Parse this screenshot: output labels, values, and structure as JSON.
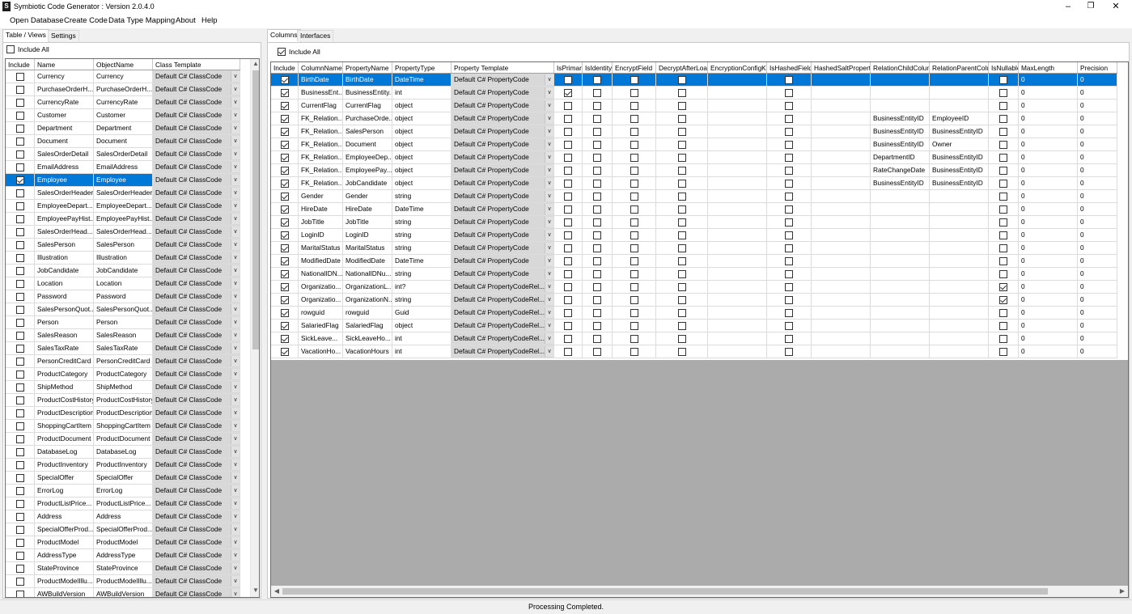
{
  "window": {
    "title": "Symbiotic Code Generator : Version 2.0.4.0"
  },
  "menu": [
    "Open Database",
    "Create Code",
    "Data Type Mapping",
    "About",
    "Help"
  ],
  "left_tabs": [
    "Table / Views",
    "Settings"
  ],
  "right_tabs": [
    "Columns",
    "Interfaces"
  ],
  "include_all_label": "Include All",
  "tables": {
    "headers": [
      "Include",
      "Name",
      "ObjectName",
      "Class Template"
    ],
    "template": "Default C# ClassCode",
    "rows": [
      {
        "inc": false,
        "name": "Currency",
        "obj": "Currency"
      },
      {
        "inc": false,
        "name": "PurchaseOrderH...",
        "obj": "PurchaseOrderH..."
      },
      {
        "inc": false,
        "name": "CurrencyRate",
        "obj": "CurrencyRate"
      },
      {
        "inc": false,
        "name": "Customer",
        "obj": "Customer"
      },
      {
        "inc": false,
        "name": "Department",
        "obj": "Department"
      },
      {
        "inc": false,
        "name": "Document",
        "obj": "Document"
      },
      {
        "inc": false,
        "name": "SalesOrderDetail",
        "obj": "SalesOrderDetail"
      },
      {
        "inc": false,
        "name": "EmailAddress",
        "obj": "EmailAddress"
      },
      {
        "inc": true,
        "name": "Employee",
        "obj": "Employee",
        "selected": true
      },
      {
        "inc": false,
        "name": "SalesOrderHeader",
        "obj": "SalesOrderHeader"
      },
      {
        "inc": false,
        "name": "EmployeeDepart...",
        "obj": "EmployeeDepart..."
      },
      {
        "inc": false,
        "name": "EmployeePayHist...",
        "obj": "EmployeePayHist..."
      },
      {
        "inc": false,
        "name": "SalesOrderHead...",
        "obj": "SalesOrderHead..."
      },
      {
        "inc": false,
        "name": "SalesPerson",
        "obj": "SalesPerson"
      },
      {
        "inc": false,
        "name": "Illustration",
        "obj": "Illustration"
      },
      {
        "inc": false,
        "name": "JobCandidate",
        "obj": "JobCandidate"
      },
      {
        "inc": false,
        "name": "Location",
        "obj": "Location"
      },
      {
        "inc": false,
        "name": "Password",
        "obj": "Password"
      },
      {
        "inc": false,
        "name": "SalesPersonQuot...",
        "obj": "SalesPersonQuot..."
      },
      {
        "inc": false,
        "name": "Person",
        "obj": "Person"
      },
      {
        "inc": false,
        "name": "SalesReason",
        "obj": "SalesReason"
      },
      {
        "inc": false,
        "name": "SalesTaxRate",
        "obj": "SalesTaxRate"
      },
      {
        "inc": false,
        "name": "PersonCreditCard",
        "obj": "PersonCreditCard"
      },
      {
        "inc": false,
        "name": "ProductCategory",
        "obj": "ProductCategory"
      },
      {
        "inc": false,
        "name": "ShipMethod",
        "obj": "ShipMethod"
      },
      {
        "inc": false,
        "name": "ProductCostHistory",
        "obj": "ProductCostHistory"
      },
      {
        "inc": false,
        "name": "ProductDescription",
        "obj": "ProductDescription"
      },
      {
        "inc": false,
        "name": "ShoppingCartItem",
        "obj": "ShoppingCartItem"
      },
      {
        "inc": false,
        "name": "ProductDocument",
        "obj": "ProductDocument"
      },
      {
        "inc": false,
        "name": "DatabaseLog",
        "obj": "DatabaseLog"
      },
      {
        "inc": false,
        "name": "ProductInventory",
        "obj": "ProductInventory"
      },
      {
        "inc": false,
        "name": "SpecialOffer",
        "obj": "SpecialOffer"
      },
      {
        "inc": false,
        "name": "ErrorLog",
        "obj": "ErrorLog"
      },
      {
        "inc": false,
        "name": "ProductListPrice...",
        "obj": "ProductListPrice..."
      },
      {
        "inc": false,
        "name": "Address",
        "obj": "Address"
      },
      {
        "inc": false,
        "name": "SpecialOfferProd...",
        "obj": "SpecialOfferProd..."
      },
      {
        "inc": false,
        "name": "ProductModel",
        "obj": "ProductModel"
      },
      {
        "inc": false,
        "name": "AddressType",
        "obj": "AddressType"
      },
      {
        "inc": false,
        "name": "StateProvince",
        "obj": "StateProvince"
      },
      {
        "inc": false,
        "name": "ProductModelIllu...",
        "obj": "ProductModelIllu..."
      },
      {
        "inc": false,
        "name": "AWBuildVersion",
        "obj": "AWBuildVersion"
      }
    ]
  },
  "columns": {
    "headers": [
      "Include",
      "ColumnName",
      "PropertyName",
      "PropertyType",
      "Property Template",
      "IsPrimary",
      "IsIdentity",
      "EncryptField",
      "DecryptAfterLoad",
      "EncryptionConfigKe",
      "IsHashedField",
      "HashedSaltProperty",
      "RelationChildColum",
      "RelationParentColu",
      "IsNullable",
      "MaxLength",
      "Precision"
    ],
    "rows": [
      {
        "col": "BirthDate",
        "prop": "BirthDate",
        "type": "DateTime",
        "tpl": "Default C# PropertyCode",
        "pk": false,
        "nul": false,
        "child": "",
        "parent": "",
        "max": "0",
        "prec": "0",
        "selected": true
      },
      {
        "col": "BusinessEnt...",
        "prop": "BusinessEntity...",
        "type": "int",
        "tpl": "Default C# PropertyCode",
        "pk": true,
        "nul": false,
        "child": "",
        "parent": "",
        "max": "0",
        "prec": "0"
      },
      {
        "col": "CurrentFlag",
        "prop": "CurrentFlag",
        "type": "object",
        "tpl": "Default C# PropertyCode",
        "pk": false,
        "nul": false,
        "child": "",
        "parent": "",
        "max": "0",
        "prec": "0"
      },
      {
        "col": "FK_Relation...",
        "prop": "PurchaseOrde...",
        "type": "object",
        "tpl": "Default C# PropertyCode",
        "pk": false,
        "nul": false,
        "child": "BusinessEntityID",
        "parent": "EmployeeID",
        "max": "0",
        "prec": "0"
      },
      {
        "col": "FK_Relation...",
        "prop": "SalesPerson",
        "type": "object",
        "tpl": "Default C# PropertyCode",
        "pk": false,
        "nul": false,
        "child": "BusinessEntityID",
        "parent": "BusinessEntityID",
        "max": "0",
        "prec": "0"
      },
      {
        "col": "FK_Relation...",
        "prop": "Document",
        "type": "object",
        "tpl": "Default C# PropertyCode",
        "pk": false,
        "nul": false,
        "child": "BusinessEntityID",
        "parent": "Owner",
        "max": "0",
        "prec": "0"
      },
      {
        "col": "FK_Relation...",
        "prop": "EmployeeDep...",
        "type": "object",
        "tpl": "Default C# PropertyCode",
        "pk": false,
        "nul": false,
        "child": "DepartmentID",
        "parent": "BusinessEntityID",
        "max": "0",
        "prec": "0"
      },
      {
        "col": "FK_Relation...",
        "prop": "EmployeePay...",
        "type": "object",
        "tpl": "Default C# PropertyCode",
        "pk": false,
        "nul": false,
        "child": "RateChangeDate",
        "parent": "BusinessEntityID",
        "max": "0",
        "prec": "0"
      },
      {
        "col": "FK_Relation...",
        "prop": "JobCandidate",
        "type": "object",
        "tpl": "Default C# PropertyCode",
        "pk": false,
        "nul": false,
        "child": "BusinessEntityID",
        "parent": "BusinessEntityID",
        "max": "0",
        "prec": "0"
      },
      {
        "col": "Gender",
        "prop": "Gender",
        "type": "string",
        "tpl": "Default C# PropertyCode",
        "pk": false,
        "nul": false,
        "child": "",
        "parent": "",
        "max": "0",
        "prec": "0"
      },
      {
        "col": "HireDate",
        "prop": "HireDate",
        "type": "DateTime",
        "tpl": "Default C# PropertyCode",
        "pk": false,
        "nul": false,
        "child": "",
        "parent": "",
        "max": "0",
        "prec": "0"
      },
      {
        "col": "JobTitle",
        "prop": "JobTitle",
        "type": "string",
        "tpl": "Default C# PropertyCode",
        "pk": false,
        "nul": false,
        "child": "",
        "parent": "",
        "max": "0",
        "prec": "0"
      },
      {
        "col": "LoginID",
        "prop": "LoginID",
        "type": "string",
        "tpl": "Default C# PropertyCode",
        "pk": false,
        "nul": false,
        "child": "",
        "parent": "",
        "max": "0",
        "prec": "0"
      },
      {
        "col": "MaritalStatus",
        "prop": "MaritalStatus",
        "type": "string",
        "tpl": "Default C# PropertyCode",
        "pk": false,
        "nul": false,
        "child": "",
        "parent": "",
        "max": "0",
        "prec": "0"
      },
      {
        "col": "ModifiedDate",
        "prop": "ModifiedDate",
        "type": "DateTime",
        "tpl": "Default C# PropertyCode",
        "pk": false,
        "nul": false,
        "child": "",
        "parent": "",
        "max": "0",
        "prec": "0"
      },
      {
        "col": "NationalIDN...",
        "prop": "NationalIDNu...",
        "type": "string",
        "tpl": "Default C# PropertyCode",
        "pk": false,
        "nul": false,
        "child": "",
        "parent": "",
        "max": "0",
        "prec": "0"
      },
      {
        "col": "Organizatio...",
        "prop": "OrganizationL...",
        "type": "int?",
        "tpl": "Default C# PropertyCodeRel...",
        "pk": false,
        "nul": true,
        "child": "",
        "parent": "",
        "max": "0",
        "prec": "0"
      },
      {
        "col": "Organizatio...",
        "prop": "OrganizationN...",
        "type": "string",
        "tpl": "Default C# PropertyCodeRel...",
        "pk": false,
        "nul": true,
        "child": "",
        "parent": "",
        "max": "0",
        "prec": "0"
      },
      {
        "col": "rowguid",
        "prop": "rowguid",
        "type": "Guid",
        "tpl": "Default C# PropertyCodeRel...",
        "pk": false,
        "nul": false,
        "child": "",
        "parent": "",
        "max": "0",
        "prec": "0"
      },
      {
        "col": "SalariedFlag",
        "prop": "SalariedFlag",
        "type": "object",
        "tpl": "Default C# PropertyCodeRel...",
        "pk": false,
        "nul": false,
        "child": "",
        "parent": "",
        "max": "0",
        "prec": "0"
      },
      {
        "col": "SickLeave...",
        "prop": "SickLeaveHo...",
        "type": "int",
        "tpl": "Default C# PropertyCodeRel...",
        "pk": false,
        "nul": false,
        "child": "",
        "parent": "",
        "max": "0",
        "prec": "0"
      },
      {
        "col": "VacationHo...",
        "prop": "VacationHours",
        "type": "int",
        "tpl": "Default C# PropertyCodeRel...",
        "pk": false,
        "nul": false,
        "child": "",
        "parent": "",
        "max": "0",
        "prec": "0"
      }
    ]
  },
  "status": "Processing Completed."
}
